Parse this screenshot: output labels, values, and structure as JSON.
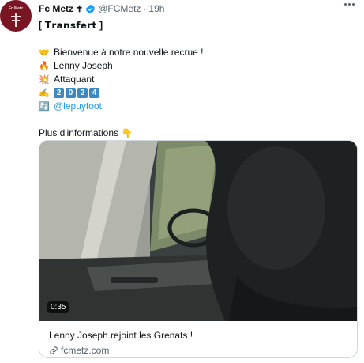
{
  "tweet": {
    "author_name": "Fc Metz",
    "author_cross": "✝",
    "handle": "@FCMetz",
    "separator": "·",
    "time": "19h",
    "avatar_label": "Fc Metz",
    "lines": {
      "tag": "[ 𝗧𝗿𝗮𝗻𝘀𝗳𝗲𝗿𝘁 ]",
      "welcome": "Bienvenue à notre nouvelle recrue !",
      "player": "Lenny Joseph",
      "position": "Attaquant",
      "year_digits": [
        "2",
        "0",
        "2",
        "4"
      ],
      "mention": "@lepuyfoot",
      "more_info": "Plus d'informations"
    },
    "emojis": {
      "welcome": "🤝",
      "player": "🔥",
      "position": "💥",
      "year": "✍",
      "mention": "🔄",
      "more_info": "👇"
    }
  },
  "card": {
    "video_duration": "0:35",
    "title": "Lenny Joseph rejoint les Grenats !",
    "domain": "fcmetz.com"
  },
  "colors": {
    "accent": "#1d9bf0",
    "avatar_bg": "#7a1524",
    "secondary_text": "#536471",
    "border": "#cfd9de"
  },
  "icons": {
    "verified": "verified-badge-icon",
    "more": "more-options-icon",
    "link": "link-icon"
  }
}
